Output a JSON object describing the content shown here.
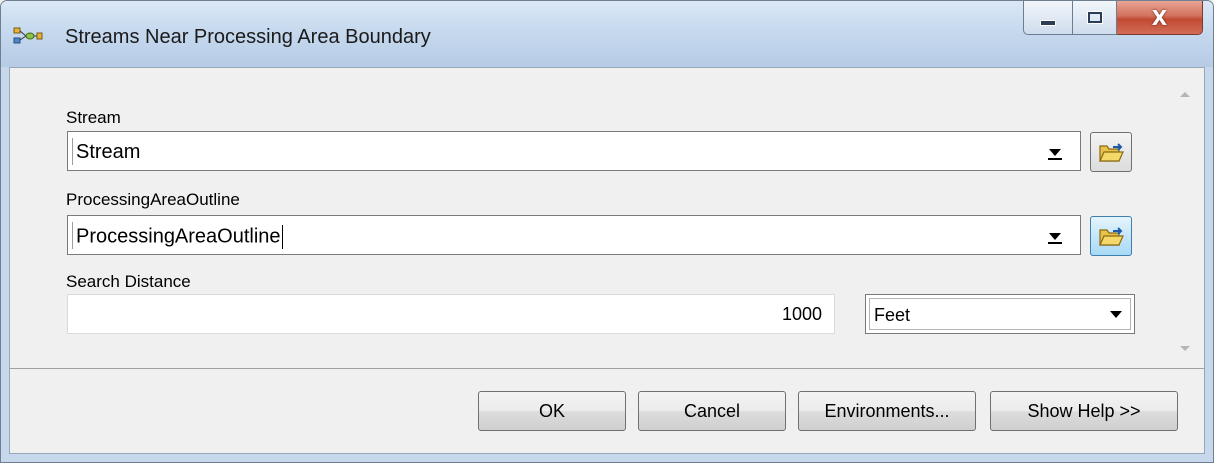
{
  "window": {
    "title": "Streams Near Processing Area Boundary",
    "controls": [
      "minimize-icon",
      "maximize-icon",
      "close-icon"
    ],
    "close_glyph": "X"
  },
  "form": {
    "stream": {
      "label": "Stream",
      "value": "Stream"
    },
    "processing_area": {
      "label": "ProcessingAreaOutline",
      "value": "ProcessingAreaOutline"
    },
    "search_distance": {
      "label": "Search Distance",
      "value": "1000",
      "units": "Feet"
    }
  },
  "buttons": {
    "ok": "OK",
    "cancel": "Cancel",
    "environments": "Environments...",
    "show_help": "Show Help >>"
  },
  "colors": {
    "browse_active": "#a7d9f5",
    "close_button": "#c24a33"
  }
}
